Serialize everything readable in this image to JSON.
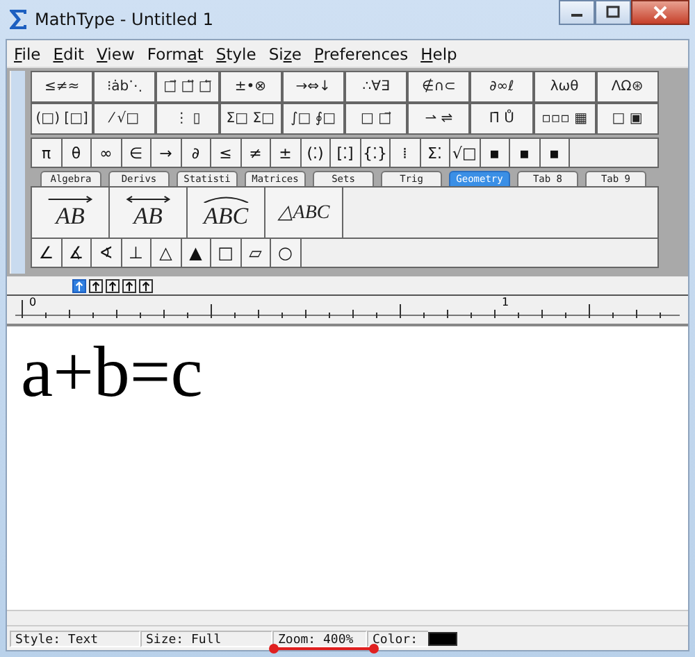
{
  "window": {
    "title": "MathType - Untitled 1"
  },
  "menu": [
    "File",
    "Edit",
    "View",
    "Format",
    "Style",
    "Size",
    "Preferences",
    "Help"
  ],
  "symbol_palettes": [
    [
      "≤≠≈",
      "⁝ȧb⋱",
      "□⃗ □⃡ □⃖",
      "±•⊗",
      "→⇔↓",
      "∴∀∃",
      "∉∩⊂",
      "∂∞ℓ",
      "λωθ",
      "ΛΩ⊛"
    ],
    [
      "(□) [□]",
      "⁄ √□",
      "⋮ ▯",
      "Σ□ Σ□",
      "∫□ ∮□",
      "□ □⃗",
      "⇀ ⇌",
      "Π̄ Ů",
      "▫▫▫ ▦",
      "□ ▣"
    ]
  ],
  "small_symbols": [
    "π",
    "θ",
    "∞",
    "∈",
    "→",
    "∂",
    "≤",
    "≠",
    "±",
    "(⁚)",
    "[⁚]",
    "{⁚}",
    "⁞",
    "Σ⁚",
    "√□",
    "▪",
    "▪",
    "▪"
  ],
  "tabs": [
    {
      "label": "Algebra",
      "selected": false
    },
    {
      "label": "Derivs",
      "selected": false
    },
    {
      "label": "Statisti",
      "selected": false
    },
    {
      "label": "Matrices",
      "selected": false
    },
    {
      "label": "Sets",
      "selected": false
    },
    {
      "label": "Trig",
      "selected": false
    },
    {
      "label": "Geometry",
      "selected": true
    },
    {
      "label": "Tab 8",
      "selected": false
    },
    {
      "label": "Tab 9",
      "selected": false
    }
  ],
  "templates": [
    {
      "text": "AB",
      "kind": "arrow"
    },
    {
      "text": "AB",
      "kind": "double-arrow"
    },
    {
      "text": "ABC",
      "kind": "arc"
    },
    {
      "text": "△ABC",
      "kind": "plain"
    }
  ],
  "geometry_symbols": [
    "∠",
    "∡",
    "∢",
    "⊥",
    "△",
    "▲",
    "□",
    "▱",
    "○"
  ],
  "view_buttons": [
    {
      "selected": true
    },
    {
      "selected": false
    },
    {
      "selected": false
    },
    {
      "selected": false
    },
    {
      "selected": false
    }
  ],
  "ruler": {
    "labels": [
      "0",
      "1"
    ]
  },
  "document": {
    "equation": "a+b=c"
  },
  "status_bar": {
    "style": "Style: Text",
    "size": "Size: Full",
    "zoom": "Zoom: 400%",
    "color_label": "Color:",
    "color": "#000000"
  }
}
